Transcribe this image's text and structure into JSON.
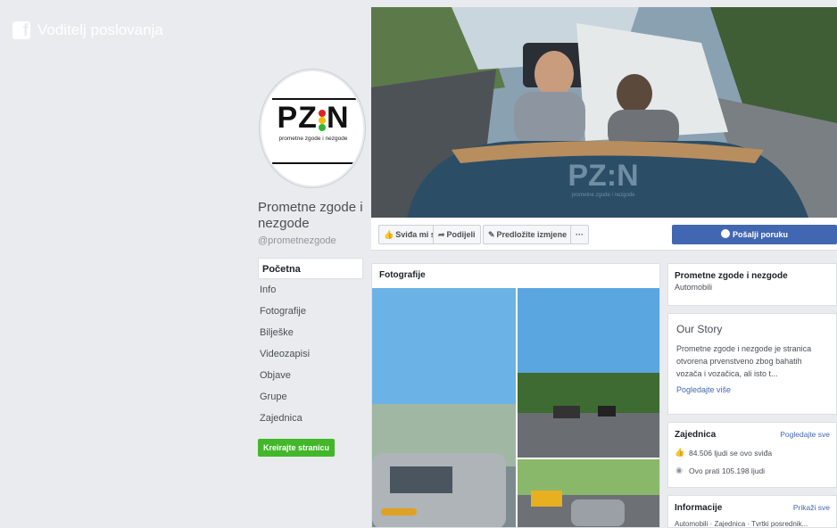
{
  "business_bar": {
    "title": "Voditelj poslovanja",
    "icon": "facebook-icon"
  },
  "profile": {
    "logo_text": "PZ",
    "logo_text_end": "N",
    "logo_subtitle": "prometne zgode i nezgode",
    "name": "Prometne zgode i nezgode",
    "handle": "@prometnezgode"
  },
  "nav": {
    "items": [
      "Početna",
      "Info",
      "Fotografije",
      "Bilješke",
      "Videozapisi",
      "Objave",
      "Grupe",
      "Zajednica"
    ],
    "create_button": "Kreirajte stranicu"
  },
  "cover": {
    "watermark": "PZ:N",
    "watermark_sub": "prometne zgode i nezgode"
  },
  "actions": {
    "like": "Sviđa mi se",
    "share": "Podijeli",
    "suggest": "Predložite izmjene",
    "more": "···",
    "message": "Pošalji poruku"
  },
  "photos": {
    "title": "Fotografije"
  },
  "info_card": {
    "title": "Prometne zgode i nezgode",
    "category": "Automobili"
  },
  "story": {
    "title": "Our Story",
    "body": "Prometne zgode i nezgode je stranica otvorena prvenstveno zbog bahatih vozača i vozačica, ali isto t...",
    "link": "Pogledajte više"
  },
  "community": {
    "title": "Zajednica",
    "link": "Pogledajte sve",
    "likes": "84.506 ljudi se ovo sviđa",
    "follows": "Ovo prati 105.198 ljudi"
  },
  "information": {
    "title": "Informacije",
    "link": "Prikaži sve",
    "categories": "Automobili · Zajednica · Tvrtki posrednik..."
  },
  "colors": {
    "accent": "#4267b2",
    "create": "#42b72a",
    "background": "#e9ebee"
  }
}
